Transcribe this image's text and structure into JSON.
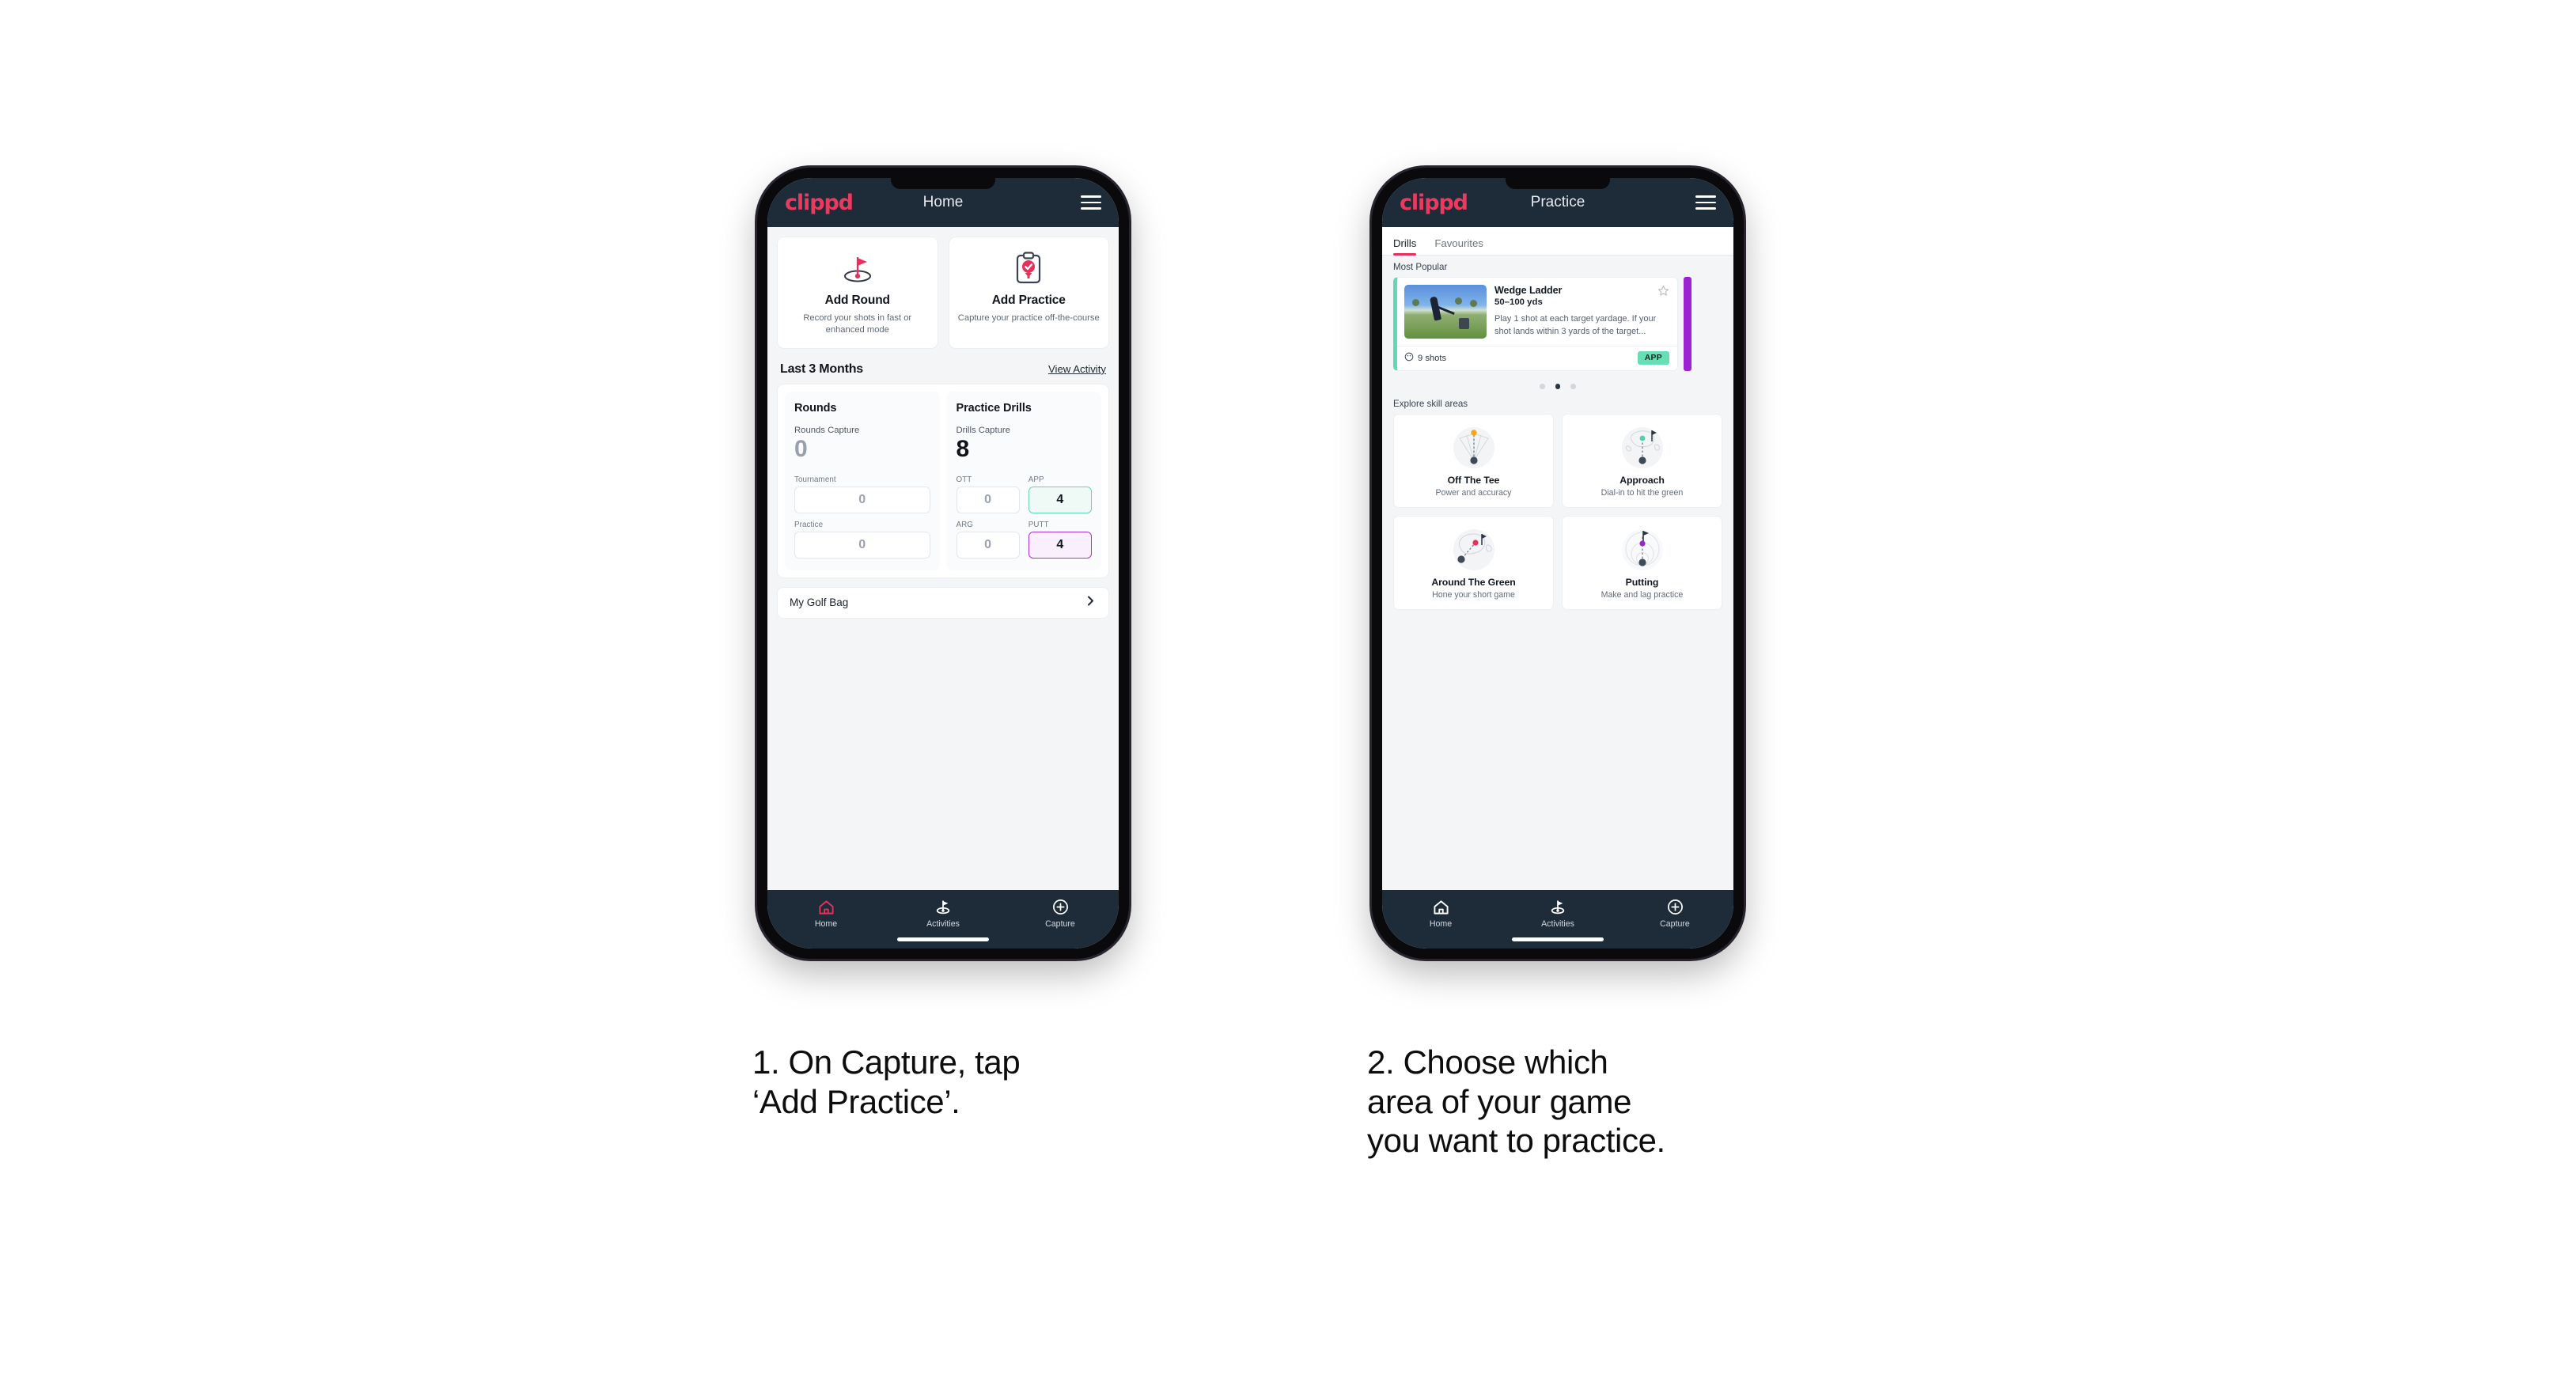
{
  "phone1": {
    "appbar": {
      "logo": "clippd",
      "title": "Home",
      "menu_icon": "hamburger-icon"
    },
    "actions": [
      {
        "icon": "golf-flag-icon",
        "title": "Add Round",
        "subtitle": "Record your shots in fast or enhanced mode"
      },
      {
        "icon": "clipboard-check-icon",
        "title": "Add Practice",
        "subtitle": "Capture your practice off-the-course"
      }
    ],
    "section": {
      "title": "Last 3 Months",
      "link": "View Activity"
    },
    "stats": {
      "rounds": {
        "heading": "Rounds",
        "capture_label": "Rounds Capture",
        "capture_value": "0",
        "fields": [
          {
            "label": "Tournament",
            "value": "0",
            "accent": "none"
          },
          {
            "label": "Practice",
            "value": "0",
            "accent": "none"
          }
        ]
      },
      "drills": {
        "heading": "Practice Drills",
        "capture_label": "Drills Capture",
        "capture_value": "8",
        "fields": [
          {
            "label": "OTT",
            "value": "0",
            "accent": "none"
          },
          {
            "label": "APP",
            "value": "4",
            "accent": "green"
          },
          {
            "label": "ARG",
            "value": "0",
            "accent": "none"
          },
          {
            "label": "PUTT",
            "value": "4",
            "accent": "purple"
          }
        ]
      }
    },
    "golf_bag": {
      "label": "My Golf Bag",
      "icon": "chevron-right-icon"
    },
    "bottom_nav": [
      {
        "icon": "home-icon",
        "label": "Home",
        "active": true
      },
      {
        "icon": "golf-flag-icon",
        "label": "Activities",
        "active": false
      },
      {
        "icon": "plus-circle-icon",
        "label": "Capture",
        "active": false
      }
    ]
  },
  "phone2": {
    "appbar": {
      "logo": "clippd",
      "title": "Practice",
      "menu_icon": "hamburger-icon"
    },
    "tabs": [
      {
        "label": "Drills",
        "active": true
      },
      {
        "label": "Favourites",
        "active": false
      }
    ],
    "most_popular_label": "Most Popular",
    "drill": {
      "name": "Wedge Ladder",
      "yardage": "50–100 yds",
      "description": "Play 1 shot at each target yardage. If your shot lands within 3 yards of the target...",
      "shots": "9 shots",
      "shots_icon": "clock-icon",
      "badge": "APP",
      "badge_color": "#67dfb4",
      "accent_color": "#5fd9b4",
      "favourite_icon": "star-outline-icon",
      "peek_color": "#9b23d0"
    },
    "carousel_dots": {
      "count": 3,
      "active_index": 1
    },
    "skills_label": "Explore skill areas",
    "skills": [
      {
        "icon": "off-the-tee-icon",
        "name": "Off The Tee",
        "sub": "Power and accuracy",
        "dot_color": "#f5a623"
      },
      {
        "icon": "approach-icon",
        "name": "Approach",
        "sub": "Dial-in to hit the green",
        "dot_color": "#4fd1b0"
      },
      {
        "icon": "around-the-green-icon",
        "name": "Around The Green",
        "sub": "Hone your short game",
        "dot_color": "#e8305a"
      },
      {
        "icon": "putting-icon",
        "name": "Putting",
        "sub": "Make and lag practice",
        "dot_color": "#9b23d0"
      }
    ],
    "bottom_nav": [
      {
        "icon": "home-icon",
        "label": "Home",
        "active": false
      },
      {
        "icon": "golf-flag-icon",
        "label": "Activities",
        "active": false
      },
      {
        "icon": "plus-circle-icon",
        "label": "Capture",
        "active": false
      }
    ]
  },
  "captions": {
    "step1": "1. On Capture, tap\n‘Add Practice’.",
    "step2": "2. Choose which\narea of your game\nyou want to practice."
  },
  "theme": {
    "brand_pink": "#ec3a5f",
    "header_dark": "#1e2c3a",
    "page_bg": "#f4f5f7"
  }
}
